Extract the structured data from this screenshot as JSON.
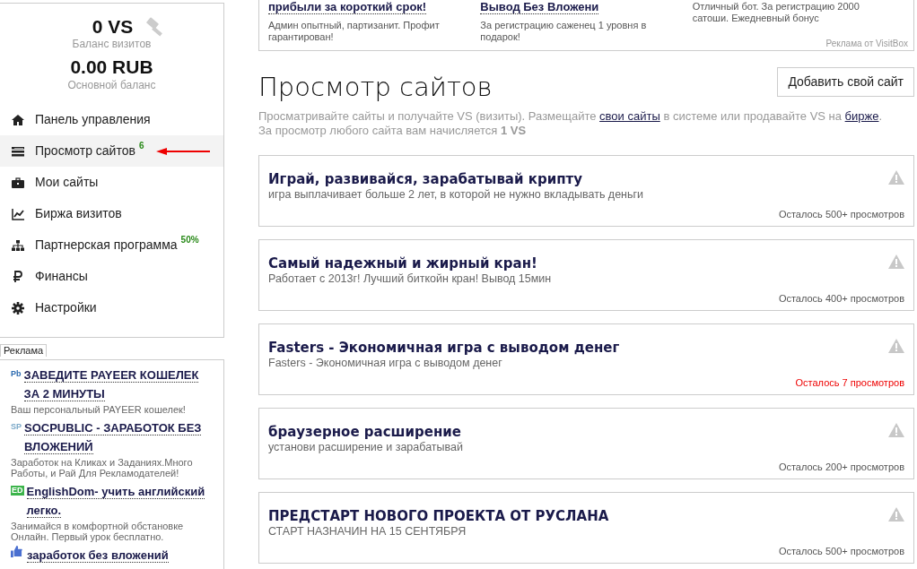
{
  "balance": {
    "visits": "0 VS",
    "visits_label": "Баланс визитов",
    "money": "0.00 RUB",
    "money_label": "Основной баланс"
  },
  "nav": [
    {
      "label": "Панель управления",
      "selected": false
    },
    {
      "label": "Просмотр сайтов",
      "badge": "6",
      "selected": true
    },
    {
      "label": "Мои сайты",
      "selected": false
    },
    {
      "label": "Биржа визитов",
      "selected": false
    },
    {
      "label": "Партнерская программа",
      "badge": "50%",
      "selected": false
    },
    {
      "label": "Финансы",
      "selected": false
    },
    {
      "label": "Настройки",
      "selected": false
    }
  ],
  "side_ads": {
    "tab": "Реклама",
    "items": [
      {
        "logo": "Pb",
        "title": "ЗАВЕДИТЕ PAYEER КОШЕЛЕК ЗА 2 МИНУТЫ",
        "text": "Ваш персональный PAYEER кошелек!"
      },
      {
        "logo": "SP",
        "title": "SOCPUBLIC - ЗАРАБОТОК БЕЗ ВЛОЖЕНИЙ",
        "text": "Заработок на Кликах и Заданиях.Много Работы, и Рай Для Рекламодателей!"
      },
      {
        "logo": "ED",
        "title": "EnglishDom- учить английский легко.",
        "text": "Занимайся в комфортной обстановке Онлайн. Первый урок бесплатно."
      },
      {
        "title": "заработок без вложений"
      }
    ]
  },
  "top_ads": {
    "items": [
      {
        "title": "прибыли за короткий срок!",
        "text": "Админ опытный, партизанит. Профит гарантирован!"
      },
      {
        "title": "Вывод Без Вложени",
        "text": "За регистрацию саженец 1 уровня в подарок!"
      },
      {
        "text": "Отличный бот. За регистрацию 2000 сатоши. Ежедневный бонус"
      }
    ],
    "credit": "Реклама от VisitBox"
  },
  "page": {
    "title": "Просмотр сайтов",
    "add_button": "Добавить свой сайт",
    "intro": [
      "Просматривайте сайты и получайте VS (визиты). Размещайте ",
      "свои сайты",
      " в системе или продавайте VS на ",
      "бирже",
      "."
    ],
    "intro2": "За просмотр любого сайта вам начисляется **1 VS**"
  },
  "sites": [
    {
      "title": "Играй, развивайся, зарабатывай крипту",
      "text": "игра выплачивает больше 2 лет, в которой не нужно вкладывать деньги",
      "remaining": "Осталось 500+ просмотров",
      "low": false
    },
    {
      "title": "Самый надежный и жирный кран!",
      "text": "Работает с 2013г! Лучший биткойн кран! Вывод 15мин",
      "remaining": "Осталось 400+ просмотров",
      "low": false
    },
    {
      "title": "Fasters - Экономичная игра с выводом денег",
      "text": "Fasters - Экономичная игра с выводом денег",
      "remaining": "Осталось 7 просмотров",
      "low": true
    },
    {
      "title": "браузерное расширение",
      "text": "установи расширение и зарабатывай",
      "remaining": "Осталось 200+ просмотров",
      "low": false
    },
    {
      "title": "ПРЕДСТАРТ НОВОГО ПРОЕКТА ОТ РУСЛАНА",
      "text": "СТАРТ НАЗНАЧИН НА 15 СЕНТЯБРЯ",
      "remaining": "Осталось 500+ просмотров",
      "low": false
    }
  ]
}
